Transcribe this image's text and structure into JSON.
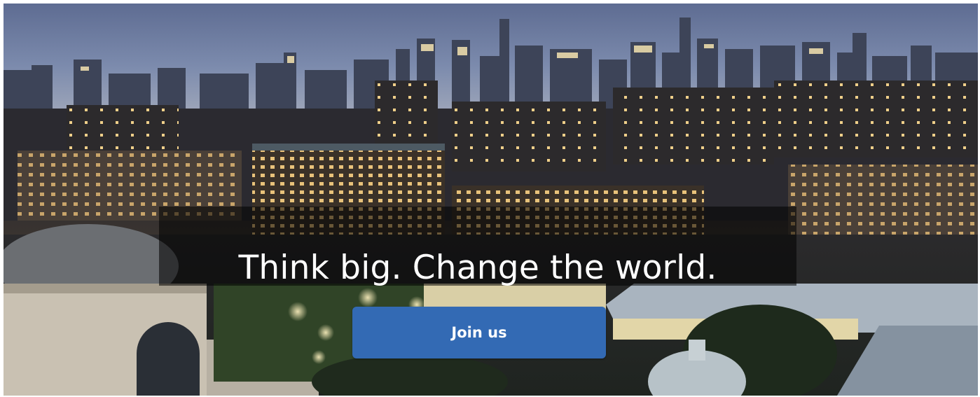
{
  "hero": {
    "headline": "Think big. Change the world.",
    "cta_label": "Join us",
    "background_image": "night-city-campus-skyline",
    "accent_color": "#336ab4"
  }
}
